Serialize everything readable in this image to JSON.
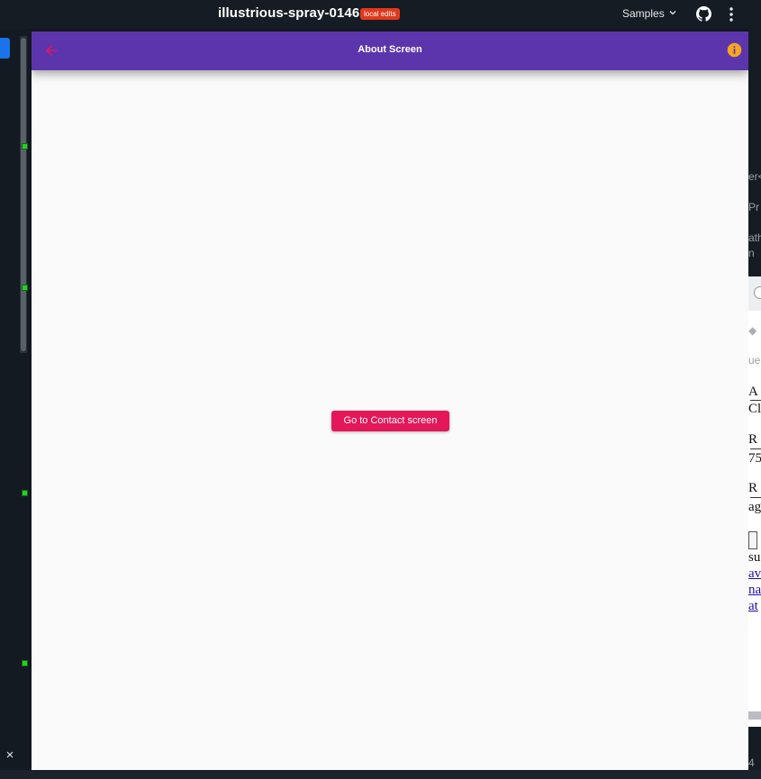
{
  "topbar": {
    "project_name": "illustrious-spray-0146",
    "badge": "local edits",
    "samples_label": "Samples",
    "icons": [
      "chevron-down-icon",
      "github-icon",
      "more-vert-icon"
    ]
  },
  "editor": {
    "close_glyph": "×"
  },
  "app": {
    "appbar": {
      "title": "About Screen",
      "back_icon": "arrow-back-icon",
      "info_icon": "info-icon"
    },
    "button_label": "Go to Contact screen"
  },
  "right_panel": {
    "fragments": [
      "er<",
      "Pr",
      "ath",
      "n",
      "ue",
      "A",
      "Cl",
      "R",
      "75",
      "R",
      "ag",
      "su",
      "av",
      "na",
      "at"
    ],
    "bottom_text": "4"
  },
  "colors": {
    "appbar_bg": "#5c35ad",
    "button_bg": "#e3175a",
    "back_icon": "#e3175a",
    "info_icon": "#f5a623",
    "badge_bg": "#e0381b",
    "marker": "#31c931"
  }
}
